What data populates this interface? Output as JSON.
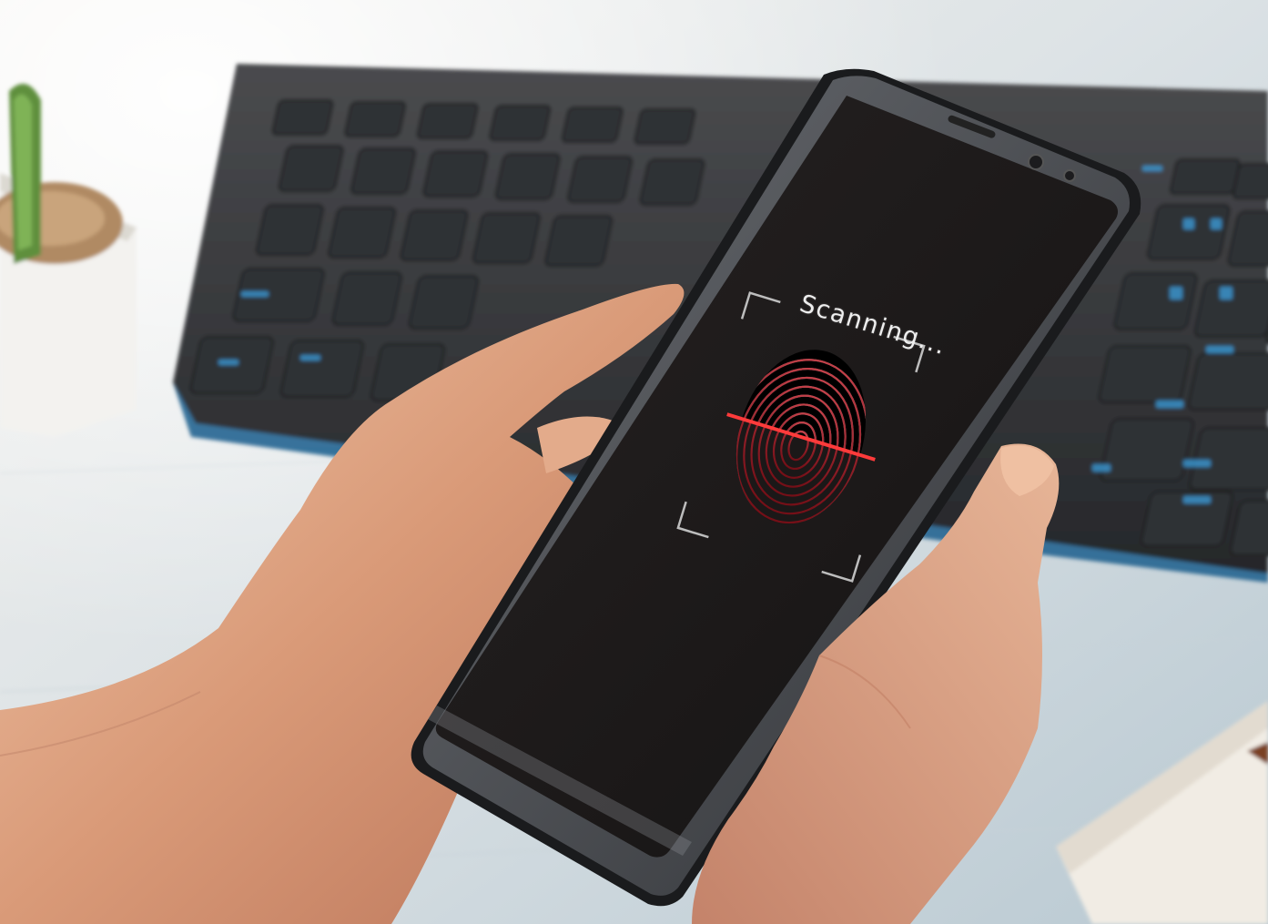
{
  "screen": {
    "status_text": "Scanning..."
  },
  "colors": {
    "scan_line": "#ff3b3b",
    "fingerprint_lower": "#d8283a",
    "fingerprint_upper": "#e8e8e8",
    "screen_background": "#1b1818",
    "keycap_legend": "#3aa0e0"
  }
}
